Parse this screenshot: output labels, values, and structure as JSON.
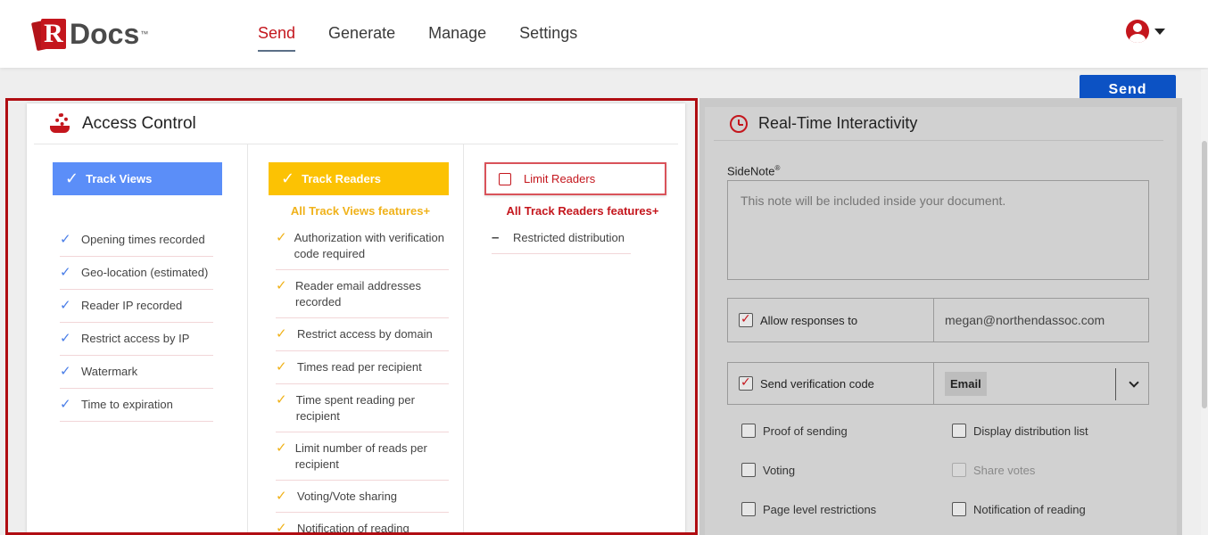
{
  "app": {
    "logo_letter": "R",
    "logo_text": "Docs",
    "logo_tm": "™"
  },
  "nav": {
    "items": [
      {
        "label": "Send",
        "active": true
      },
      {
        "label": "Generate",
        "active": false
      },
      {
        "label": "Manage",
        "active": false
      },
      {
        "label": "Settings",
        "active": false
      }
    ]
  },
  "toolbar": {
    "send_label": "Send"
  },
  "access_control": {
    "title": "Access Control",
    "track_views": {
      "label": "Track Views",
      "features": [
        "Opening times recorded",
        "Geo-location (estimated)",
        "Reader IP recorded",
        "Restrict access by IP",
        "Watermark",
        "Time to expiration"
      ]
    },
    "track_readers": {
      "label": "Track Readers",
      "plus_label": "All Track Views features+",
      "features": [
        "Authorization with verification code required",
        "Reader email addresses recorded",
        "Restrict access by domain",
        "Times read per recipient",
        "Time spent reading per recipient",
        "Limit number of reads per recipient",
        "Voting/Vote sharing",
        "Notification of reading"
      ]
    },
    "limit_readers": {
      "label": "Limit Readers",
      "plus_label": "All Track Readers features+",
      "features": [
        "Restricted distribution"
      ]
    }
  },
  "realtime": {
    "title": "Real-Time Interactivity",
    "sidenote_label": "SideNote",
    "sidenote_reg": "®",
    "sidenote_text": "This note will be included inside your document.",
    "allow_responses_label": "Allow responses to",
    "allow_responses_value": "megan@northendassoc.com",
    "send_verification_label": "Send verification code",
    "verification_method": "Email",
    "options": {
      "proof_of_sending": "Proof of sending",
      "display_distribution_list": "Display distribution list",
      "voting": "Voting",
      "share_votes": "Share votes",
      "page_level_restrictions": "Page level restrictions",
      "notification_of_reading": "Notification of reading"
    }
  },
  "colors": {
    "brand_red": "#c4161d",
    "send_blue": "#0c52c4",
    "track_views_blue": "#5b8ef8",
    "track_readers_yellow": "#fcc203"
  }
}
